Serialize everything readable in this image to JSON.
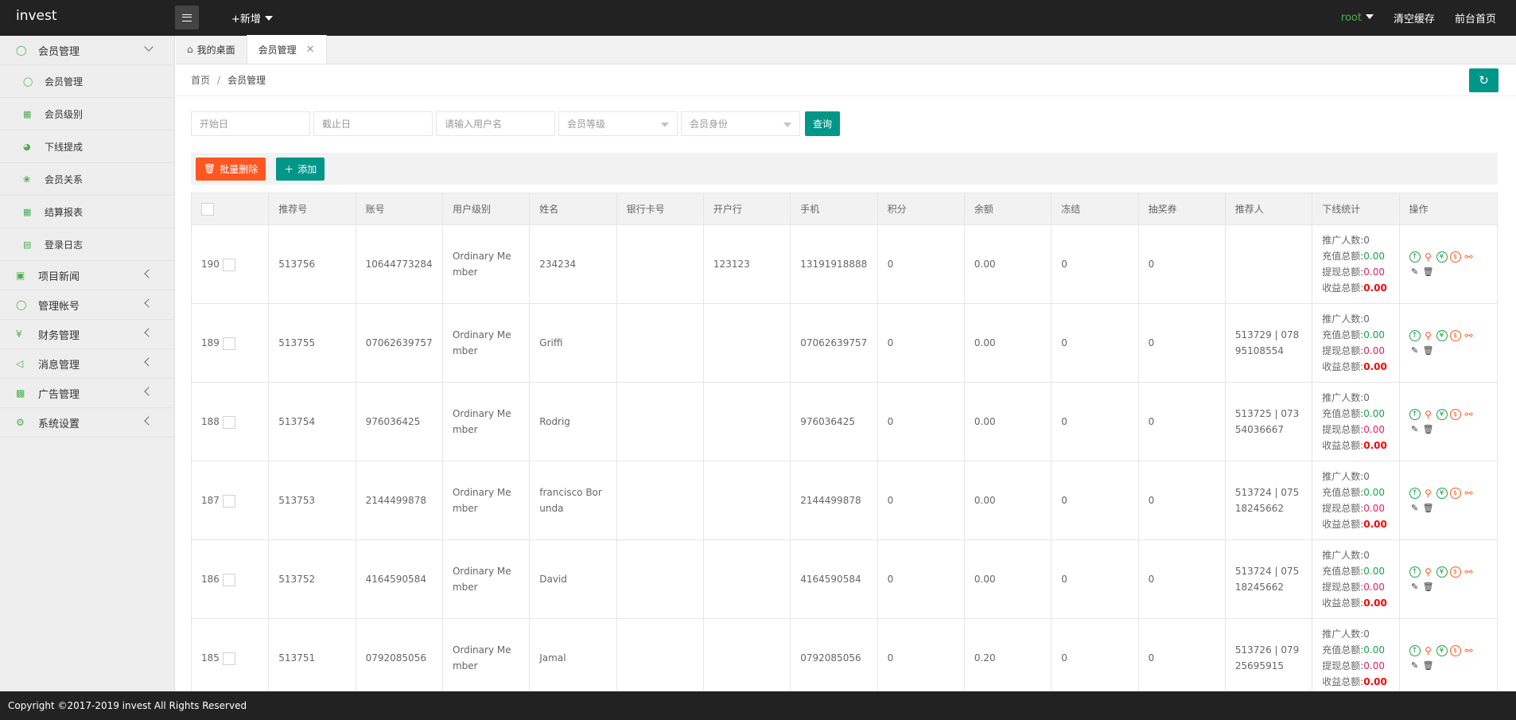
{
  "app": {
    "title": "invest"
  },
  "topbar": {
    "new_label": "+新增",
    "user": "root",
    "clear_cache": "清空缓存",
    "front_home": "前台首页"
  },
  "sidebar": {
    "groups": [
      {
        "label": "会员管理",
        "icon": "user-icon",
        "open": true,
        "items": [
          {
            "label": "会员管理",
            "icon": "user-icon"
          },
          {
            "label": "会员级别",
            "icon": "level-icon"
          },
          {
            "label": "下线提成",
            "icon": "gauge-icon"
          },
          {
            "label": "会员关系",
            "icon": "tree-icon"
          },
          {
            "label": "结算报表",
            "icon": "report-icon"
          },
          {
            "label": "登录日志",
            "icon": "log-icon"
          }
        ]
      },
      {
        "label": "项目新闻",
        "icon": "book-icon"
      },
      {
        "label": "管理帐号",
        "icon": "user-icon"
      },
      {
        "label": "财务管理",
        "icon": "yen-icon"
      },
      {
        "label": "消息管理",
        "icon": "speaker-icon"
      },
      {
        "label": "广告管理",
        "icon": "image-icon"
      },
      {
        "label": "系统设置",
        "icon": "gear-icon"
      }
    ]
  },
  "tabs": [
    {
      "label": "我的桌面"
    },
    {
      "label": "会员管理"
    }
  ],
  "breadcrumb": {
    "home": "首页",
    "sep": "/",
    "current": "会员管理"
  },
  "filters": {
    "start_placeholder": "开始日",
    "end_placeholder": "截止日",
    "username_placeholder": "请输入用户名",
    "level_select": "会员等级",
    "identity_select": "会员身份",
    "query": "查询"
  },
  "toolbar": {
    "batch_delete": "批量删除",
    "add": "添加"
  },
  "table": {
    "headers": [
      "推荐号",
      "账号",
      "用户级别",
      "姓名",
      "银行卡号",
      "开户行",
      "手机",
      "积分",
      "余额",
      "冻结",
      "抽奖券",
      "推荐人",
      "下线统计",
      "操作"
    ],
    "stat_labels": {
      "promoters": "推广人数:",
      "recharge": "充值总额:",
      "withdraw": "提现总额:",
      "income": "收益总额:"
    },
    "rows": [
      {
        "id": "190",
        "ref_no": "513756",
        "account": "10644773284",
        "level": "Ordinary Member",
        "name": "234234",
        "bank_card": "",
        "bank": "123123",
        "phone": "13191918888",
        "points": "0",
        "balance": "0.00",
        "frozen": "0",
        "lottery": "0",
        "referrer": "",
        "promoters": "0",
        "recharge": "0.00",
        "withdraw": "0.00",
        "income": "0.00"
      },
      {
        "id": "189",
        "ref_no": "513755",
        "account": "07062639757",
        "level": "Ordinary Member",
        "name": "Griffi",
        "bank_card": "",
        "bank": "",
        "phone": "07062639757",
        "points": "0",
        "balance": "0.00",
        "frozen": "0",
        "lottery": "0",
        "referrer": "513729 | 07895108554",
        "promoters": "0",
        "recharge": "0.00",
        "withdraw": "0.00",
        "income": "0.00"
      },
      {
        "id": "188",
        "ref_no": "513754",
        "account": "976036425",
        "level": "Ordinary Member",
        "name": "Rodrig",
        "bank_card": "",
        "bank": "",
        "phone": "976036425",
        "points": "0",
        "balance": "0.00",
        "frozen": "0",
        "lottery": "0",
        "referrer": "513725 | 07354036667",
        "promoters": "0",
        "recharge": "0.00",
        "withdraw": "0.00",
        "income": "0.00"
      },
      {
        "id": "187",
        "ref_no": "513753",
        "account": "2144499878",
        "level": "Ordinary Member",
        "name": "francisco Borunda",
        "bank_card": "",
        "bank": "",
        "phone": "2144499878",
        "points": "0",
        "balance": "0.00",
        "frozen": "0",
        "lottery": "0",
        "referrer": "513724 | 07518245662",
        "promoters": "0",
        "recharge": "0.00",
        "withdraw": "0.00",
        "income": "0.00"
      },
      {
        "id": "186",
        "ref_no": "513752",
        "account": "4164590584",
        "level": "Ordinary Member",
        "name": "David",
        "bank_card": "",
        "bank": "",
        "phone": "4164590584",
        "points": "0",
        "balance": "0.00",
        "frozen": "0",
        "lottery": "0",
        "referrer": "513724 | 07518245662",
        "promoters": "0",
        "recharge": "0.00",
        "withdraw": "0.00",
        "income": "0.00"
      },
      {
        "id": "185",
        "ref_no": "513751",
        "account": "0792085056",
        "level": "Ordinary Member",
        "name": "Jamal",
        "bank_card": "",
        "bank": "",
        "phone": "0792085056",
        "points": "0",
        "balance": "0.20",
        "frozen": "0",
        "lottery": "0",
        "referrer": "513726 | 07925695915",
        "promoters": "0",
        "recharge": "0.00",
        "withdraw": "0.00",
        "income": "0.00"
      }
    ]
  },
  "footer": {
    "copyright": "Copyright ©2017-2019 invest All Rights Reserved"
  },
  "colors": {
    "topbar": "#222222",
    "primary": "#009688",
    "danger": "#ff5722",
    "sidebar": "#eeeeee",
    "icon_green": "#4caf50",
    "income_red": "#ff0000",
    "withdraw_pink": "#e91e63"
  }
}
